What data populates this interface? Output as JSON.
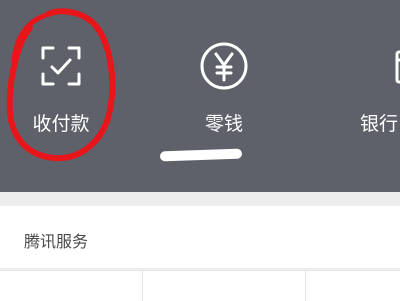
{
  "quick_actions": [
    {
      "label": "收付款",
      "icon": "scan-check-icon"
    },
    {
      "label": "零钱",
      "icon": "yuan-coin-icon"
    },
    {
      "label": "银行",
      "icon": "bank-card-icon"
    }
  ],
  "section": {
    "title": "腾讯服务"
  },
  "colors": {
    "top_bar": "#5e6169",
    "annotation": "#e8151b",
    "page_bg": "#ededed"
  }
}
